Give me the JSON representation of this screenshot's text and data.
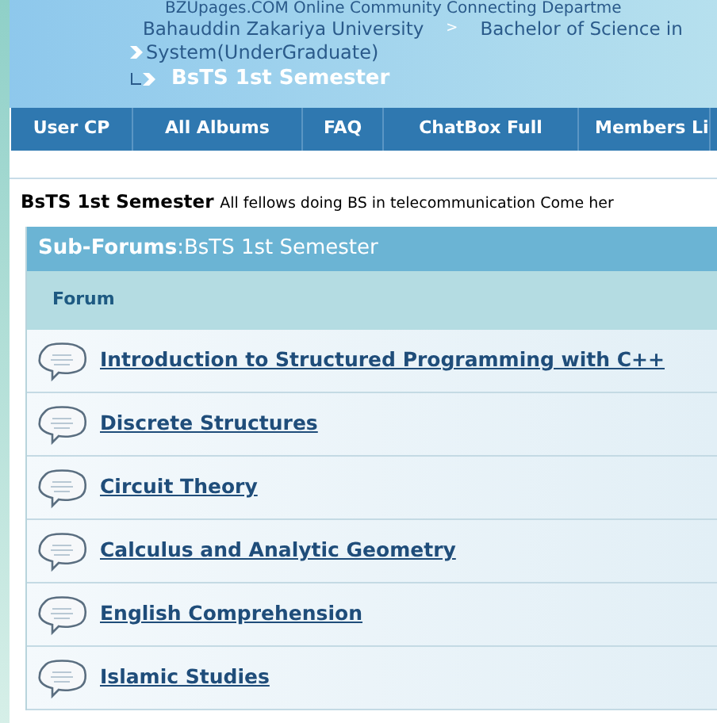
{
  "header": {
    "tagline": "BZUpages.COM Online Community Connecting Departme",
    "breadcrumb": [
      {
        "label": "Bahauddin Zakariya University"
      },
      {
        "label": "Bachelor of Science in"
      }
    ],
    "separator": ">",
    "parent": "System(UnderGraduate)",
    "current": "BsTS 1st Semester"
  },
  "nav": [
    {
      "label": "User CP"
    },
    {
      "label": "All Albums"
    },
    {
      "label": "FAQ"
    },
    {
      "label": "ChatBox Full"
    },
    {
      "label": "Members Li"
    }
  ],
  "description": {
    "title": "BsTS 1st Semester",
    "text": "All fellows doing BS in telecommunication Come her"
  },
  "subforums": {
    "title": "Sub-Forums",
    "divider": ":",
    "name": "BsTS 1st Semester",
    "column": "Forum",
    "rows": [
      {
        "label": "Introduction to Structured Programming with C++"
      },
      {
        "label": "Discrete Structures"
      },
      {
        "label": "Circuit Theory"
      },
      {
        "label": "Calculus and Analytic Geometry"
      },
      {
        "label": "English Comprehension"
      },
      {
        "label": "Islamic Studies"
      }
    ]
  }
}
